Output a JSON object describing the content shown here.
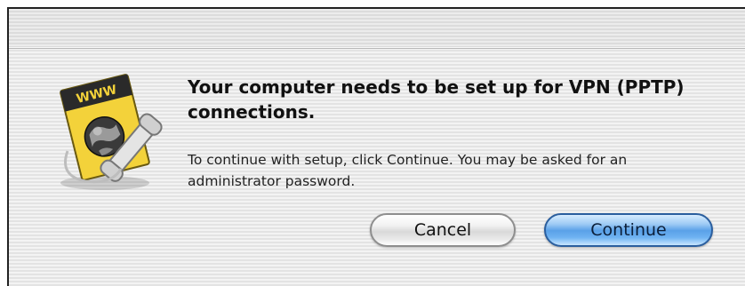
{
  "dialog": {
    "headline": "Your computer needs to be set up for VPN (PPTP) connections.",
    "body": "To continue with setup, click Continue. You may be asked for an administrator password.",
    "cancel_label": "Cancel",
    "continue_label": "Continue",
    "icon_text": "WWW",
    "icon": "internet-connect-icon"
  },
  "colors": {
    "default_button": "#5aa1e8",
    "icon_yellow": "#f3d23a"
  }
}
